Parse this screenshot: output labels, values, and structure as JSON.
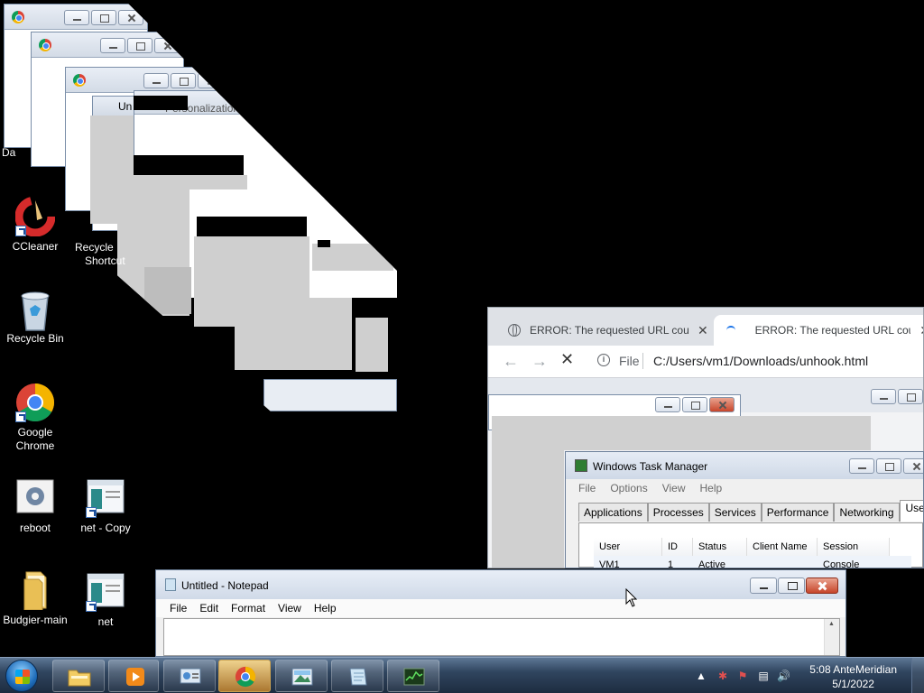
{
  "desktop": {
    "icons": [
      {
        "label": "CCleaner",
        "icon": "ccleaner-icon"
      },
      {
        "label": "Recycle Bin",
        "icon": "recycle-bin-icon"
      },
      {
        "label": "Google Chrome",
        "icon": "chrome-icon"
      },
      {
        "label": "reboot",
        "icon": "reboot-icon"
      },
      {
        "label": "net - Copy",
        "icon": "net-icon"
      },
      {
        "label": "Budgier-main",
        "icon": "folder-icon"
      },
      {
        "label": "net",
        "icon": "net-icon"
      }
    ],
    "partial_labels": {
      "da": "Da",
      "recycle_shortcut_1": "Recycle",
      "recycle_shortcut_2": "Shortcut",
      "untitled_fragment": "Un",
      "personalization_fragment": "Personalization"
    }
  },
  "chrome": {
    "tabs": [
      {
        "title": "ERROR: The requested URL could not be retrieved"
      },
      {
        "title": "ERROR: The requested URL could not be retrieved"
      }
    ],
    "address": {
      "scheme_label": "File",
      "url": "C:/Users/vm1/Downloads/unhook.html"
    },
    "icons": {
      "back": "←",
      "forward": "→",
      "stop": "✕",
      "close": "✕",
      "info": "i"
    }
  },
  "task_manager": {
    "title": "Windows Task Manager",
    "menu": [
      "File",
      "Options",
      "View",
      "Help"
    ],
    "tabs": [
      "Applications",
      "Processes",
      "Services",
      "Performance",
      "Networking",
      "Users"
    ],
    "active_tab": "Users",
    "columns": [
      "User",
      "ID",
      "Status",
      "Client Name",
      "Session"
    ],
    "rows": [
      {
        "user": "VM1",
        "id": "1",
        "status": "Active",
        "client": "",
        "session": "Console"
      }
    ]
  },
  "notepad": {
    "title": "Untitled - Notepad",
    "menu": [
      "File",
      "Edit",
      "Format",
      "View",
      "Help"
    ]
  },
  "taskbar": {
    "clock_time": "5:08 AnteMeridian",
    "clock_date": "5/1/2022"
  },
  "colors": {
    "desktop": "#000000",
    "accent": "#1a73e8",
    "close_red": "#c7452a"
  }
}
